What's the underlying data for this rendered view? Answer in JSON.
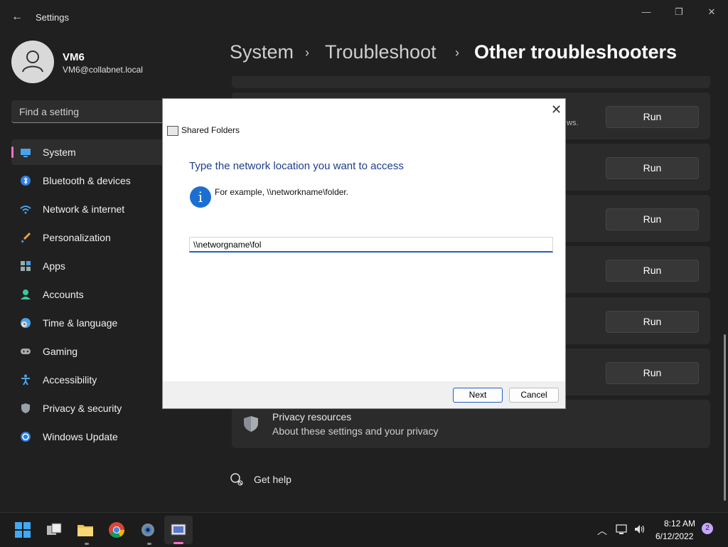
{
  "window": {
    "title": "Settings",
    "minimize_glyph": "—",
    "maximize_glyph": "❐",
    "close_glyph": "✕"
  },
  "profile": {
    "name": "VM6",
    "email": "VM6@collabnet.local"
  },
  "search": {
    "placeholder": "Find a setting"
  },
  "sidebar": {
    "items": [
      {
        "label": "System",
        "icon": "monitor-icon",
        "selected": true
      },
      {
        "label": "Bluetooth & devices",
        "icon": "bluetooth-icon"
      },
      {
        "label": "Network & internet",
        "icon": "wifi-icon"
      },
      {
        "label": "Personalization",
        "icon": "brush-icon"
      },
      {
        "label": "Apps",
        "icon": "apps-icon"
      },
      {
        "label": "Accounts",
        "icon": "person-icon"
      },
      {
        "label": "Time & language",
        "icon": "globe-clock-icon"
      },
      {
        "label": "Gaming",
        "icon": "gamepad-icon"
      },
      {
        "label": "Accessibility",
        "icon": "accessibility-icon"
      },
      {
        "label": "Privacy & security",
        "icon": "shield-icon"
      },
      {
        "label": "Windows Update",
        "icon": "update-icon"
      }
    ]
  },
  "breadcrumb": {
    "items": [
      "System",
      "Troubleshoot",
      "Other troubleshooters"
    ]
  },
  "main": {
    "run_label": "Run",
    "card_fragment": "ws.",
    "privacy": {
      "title": "Privacy resources",
      "subtitle": "About these settings and your privacy"
    },
    "get_help": "Get help"
  },
  "dialog": {
    "title": "Shared Folders",
    "heading": "Type the network location you want to access",
    "example": "For example, \\\\networkname\\folder.",
    "input_value": "\\\\networgname\\fol",
    "next_label": "Next",
    "cancel_label": "Cancel",
    "close_glyph": "✕"
  },
  "taskbar": {
    "time": "8:12 AM",
    "date": "6/12/2022",
    "notification_count": "2"
  }
}
